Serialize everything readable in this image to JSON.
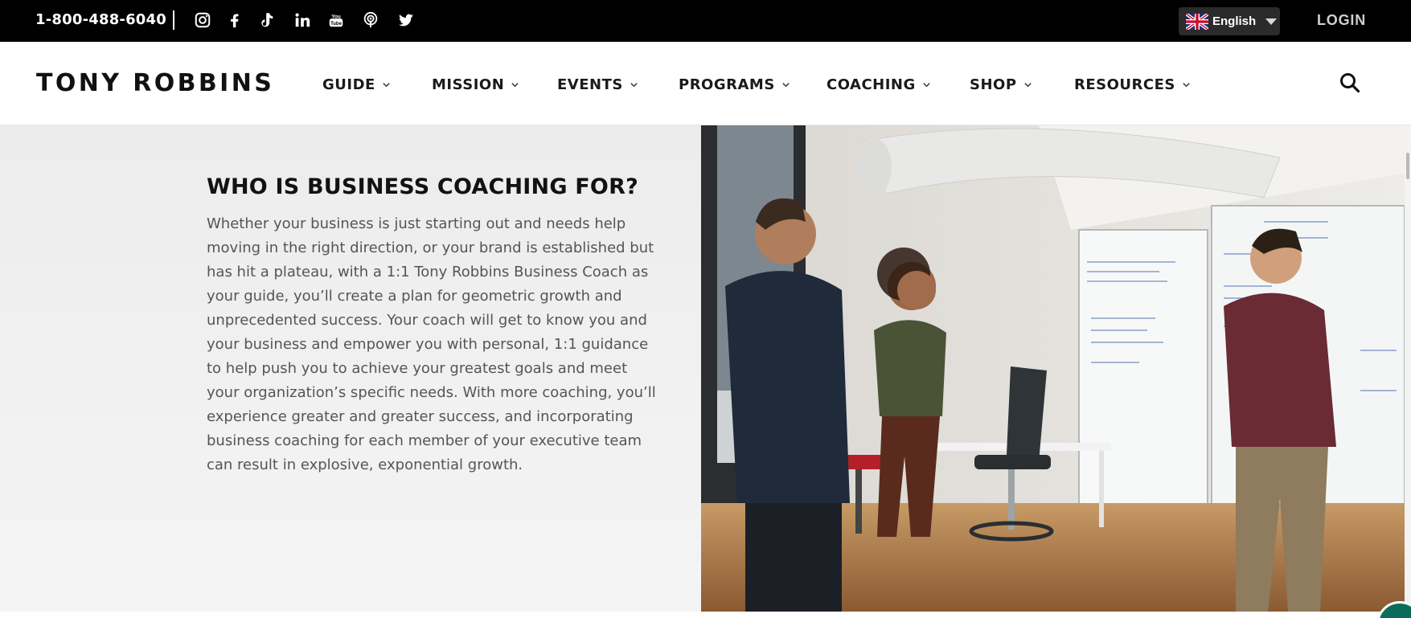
{
  "topbar": {
    "phone": "1-800-488-6040",
    "social_icons": [
      "instagram-icon",
      "facebook-icon",
      "tiktok-icon",
      "linkedin-icon",
      "youtube-icon",
      "podcast-icon",
      "twitter-icon"
    ],
    "language": {
      "label": "English",
      "flag_icon": "uk-flag-icon"
    },
    "login_label": "LOGIN"
  },
  "nav": {
    "brand": "TONY ROBBINS",
    "items": [
      {
        "label": "GUIDE"
      },
      {
        "label": "MISSION"
      },
      {
        "label": "EVENTS"
      },
      {
        "label": "PROGRAMS"
      },
      {
        "label": "COACHING"
      },
      {
        "label": "SHOP"
      },
      {
        "label": "RESOURCES"
      }
    ],
    "search_icon": "search-icon"
  },
  "content": {
    "heading": "WHO IS BUSINESS COACHING FOR?",
    "paragraph": "Whether your business is just starting out and needs help moving in the right direction, or your brand is established but has hit a plateau, with a 1:1 Tony Robbins Business Coach as your guide, you’ll create a plan for geometric growth and unprecedented success. Your coach will get to know you and your business and empower you with personal, 1:1 guidance to help push you to achieve your greatest goals and meet your organization’s specific needs. With more coaching, you’ll experience greater and greater success, and incorporating business coaching for each member of your executive team can result in explosive, exponential growth."
  },
  "colors": {
    "topbar_bg": "#000000",
    "nav_bg": "#ffffff",
    "panel_bg": "#efefef",
    "heading": "#121212",
    "body_text": "#555555"
  }
}
